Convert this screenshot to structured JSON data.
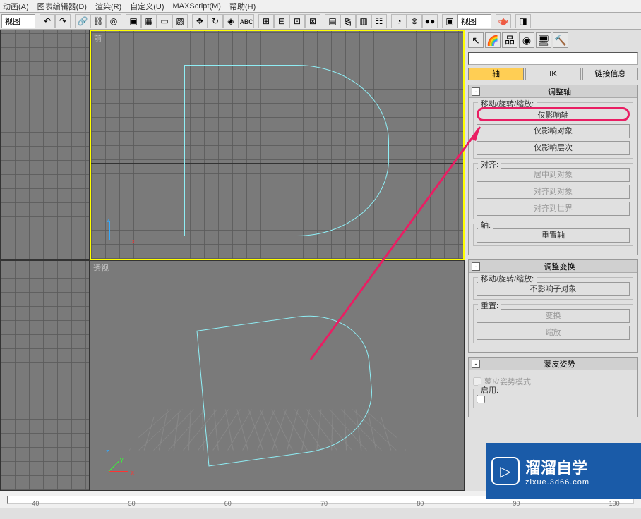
{
  "menubar": {
    "items": [
      "动画(A)",
      "图表编辑器(D)",
      "渲染(R)",
      "自定义(U)",
      "MAXScript(M)",
      "帮助(H)"
    ]
  },
  "toolbar": {
    "dropdown1": "视图",
    "dropdown2": "视图"
  },
  "viewports": {
    "top": {
      "label": "前"
    },
    "bottom": {
      "label": "透视"
    }
  },
  "sidepanel": {
    "tabs": {
      "axis": "轴",
      "ik": "IK",
      "linkinfo": "链接信息"
    },
    "rollouts": {
      "adjust_axis": {
        "title": "调整轴",
        "group_mrs": "移动/旋转/缩放:",
        "btn_affect_pivot": "仅影响轴",
        "btn_affect_object": "仅影响对象",
        "btn_affect_hierarchy": "仅影响层次",
        "group_align": "对齐:",
        "btn_center_to_object": "居中到对象",
        "btn_align_to_object": "对齐到对象",
        "btn_align_to_world": "对齐到世界",
        "group_axis": "轴:",
        "btn_reset_axis": "重置轴"
      },
      "adjust_transform": {
        "title": "调整变换",
        "group_mrs": "移动/旋转/缩放:",
        "btn_dont_affect_children": "不影响子对象",
        "group_reset": "重置:",
        "btn_transform": "变换",
        "btn_scale": "缩放"
      },
      "skin_pose": {
        "title": "蒙皮姿势",
        "chk_skin_pose_mode": "蒙皮姿势模式",
        "group_enable": "启用:"
      }
    }
  },
  "ruler": {
    "ticks": [
      "40",
      "50",
      "60",
      "70",
      "80",
      "90",
      "100"
    ]
  },
  "watermark": {
    "title": "溜溜自学",
    "url": "zixue.3d66.com"
  }
}
